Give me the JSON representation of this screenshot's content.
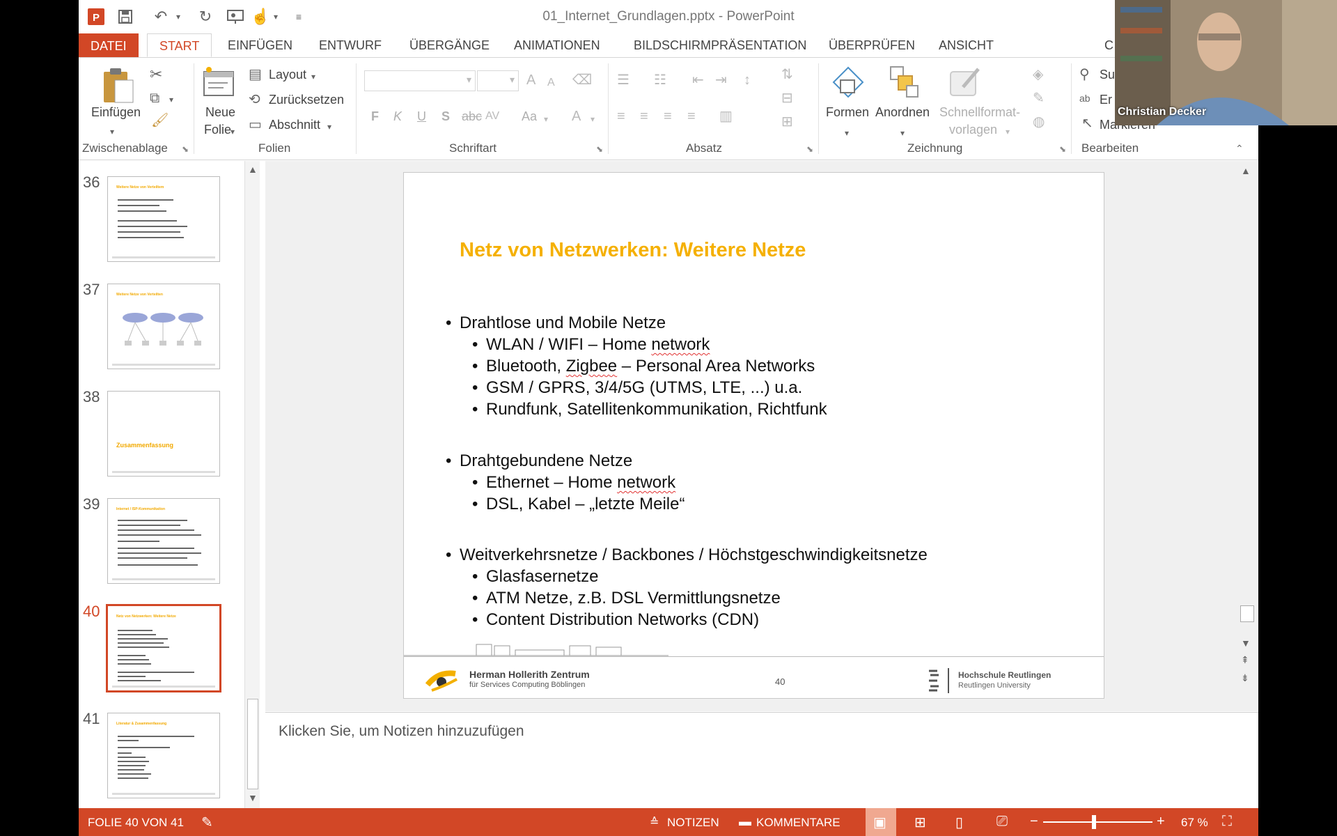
{
  "window_title": "01_Internet_Grundlagen.pptx - PowerPoint",
  "quick_access": [
    "powerpoint-logo-icon",
    "save-icon",
    "undo-icon",
    "redo-icon",
    "present-from-start-icon",
    "touch-mode-icon",
    "customize-icon"
  ],
  "tabs": [
    "DATEI",
    "START",
    "EINFÜGEN",
    "ENTWURF",
    "ÜBERGÄNGE",
    "ANIMATIONEN",
    "BILDSCHIRMPRÄSENTATION",
    "ÜBERPRÜFEN",
    "ANSICHT",
    "C"
  ],
  "ribbon": {
    "clipboard": {
      "paste": "Einfügen",
      "label": "Zwischenablage"
    },
    "slides": {
      "new_slide_1": "Neue",
      "new_slide_2": "Folie",
      "layout": "Layout",
      "reset": "Zurücksetzen",
      "section": "Abschnitt",
      "label": "Folien"
    },
    "font": {
      "label": "Schriftart",
      "bold": "F",
      "italic": "K",
      "underline": "U",
      "shadow": "S",
      "strike": "abc",
      "case": "Aa"
    },
    "paragraph": {
      "label": "Absatz"
    },
    "drawing": {
      "shapes": "Formen",
      "arrange": "Anordnen",
      "quick_styles_1": "Schnellformat-",
      "quick_styles_2": "vorlagen",
      "label": "Zeichnung"
    },
    "editing": {
      "find": "Su",
      "replace": "Er",
      "select": "Markieren",
      "label": "Bearbeiten"
    }
  },
  "webcam": {
    "name": "Christian Decker"
  },
  "thumbnails": [
    {
      "number": "36",
      "title": "Weitere Netze von Verteiltem"
    },
    {
      "number": "37",
      "title": "Weitere Netze von Verteilten"
    },
    {
      "number": "38",
      "title": "Zusammenfassung"
    },
    {
      "number": "39",
      "title": "Internet / ISP-Kommunikation"
    },
    {
      "number": "40",
      "title": "Netz von Netzwerken: Weitere Netze"
    },
    {
      "number": "41",
      "title": "Literatur & Zusammenfassung"
    }
  ],
  "slide": {
    "title": "Netz von Netzwerken: Weitere Netze",
    "sections": [
      {
        "heading": "Drahtlose und Mobile Netze",
        "items": [
          "WLAN / WIFI – Home ",
          "Bluetooth, ",
          "GSM / GPRS, 3/4/5G (UTMS, LTE, ...) u.a.",
          "Rundfunk, Satellitenkommunikation, Richtfunk"
        ]
      },
      {
        "heading": "Drahtgebundene Netze",
        "items": [
          "Ethernet – Home ",
          "DSL, Kabel – „letzte Meile“"
        ]
      },
      {
        "heading": "Weitverkehrsnetze / Backbones / Höchstgeschwindigkeitsnetze",
        "items": [
          "Glasfasernetze",
          "ATM Netze, z.B. DSL Vermittlungsnetze",
          "Content Distribution Networks (CDN)"
        ]
      }
    ],
    "w_network": "network",
    "w_zigbee": "Zigbee",
    "w_pan": " – Personal Area Networks",
    "footer_logo_1": "Herman Hollerith Zentrum",
    "footer_logo_2": "für Services Computing Böblingen",
    "page_number": "40",
    "univ_1": "Hochschule Reutlingen",
    "univ_2": "Reutlingen University"
  },
  "notes_placeholder": "Klicken Sie, um Notizen hinzuzufügen",
  "status": {
    "slide_count": "FOLIE 40 VON 41",
    "notes": "NOTIZEN",
    "comments": "KOMMENTARE",
    "zoom": "67 %"
  },
  "colors": {
    "accent": "#d24726",
    "slide_title": "#f5b000"
  }
}
